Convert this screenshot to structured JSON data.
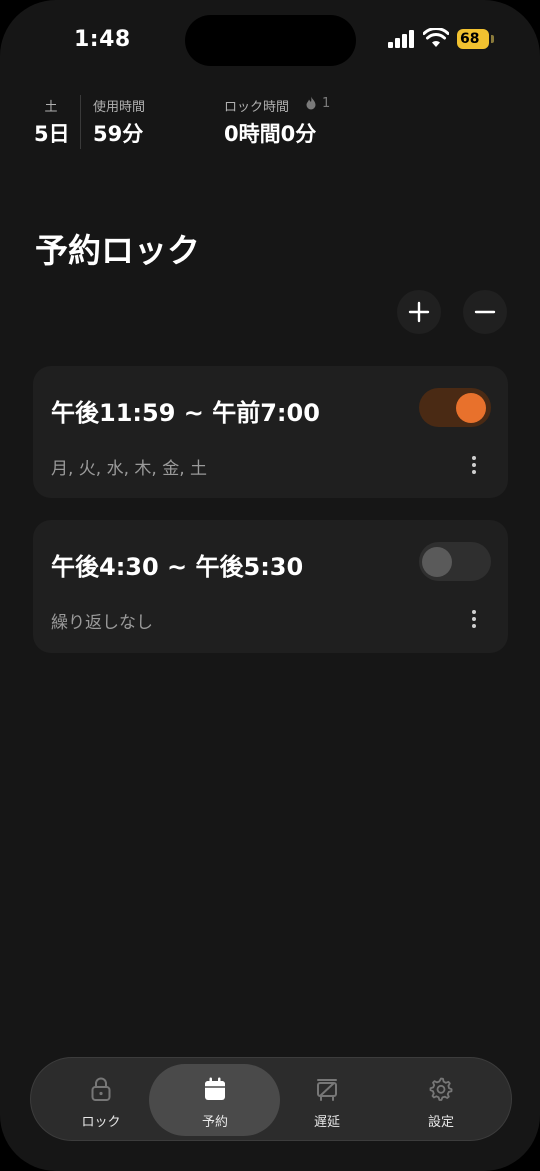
{
  "status_bar": {
    "time": "1:48",
    "battery_percent": "68",
    "signal_bars": 4,
    "charging": true
  },
  "stats": {
    "day_label": "土",
    "day_value": "5日",
    "usage_label": "使用時間",
    "usage_value": "59分",
    "lock_label": "ロック時間",
    "lock_streak": "1",
    "lock_value": "0時間0分"
  },
  "page": {
    "title": "予約ロック"
  },
  "actions": {
    "add_icon": "plus-icon",
    "remove_icon": "minus-icon"
  },
  "schedules": [
    {
      "time_range": "午後11:59 ~ 午前7:00",
      "days": "月, 火, 水, 木, 金, 土",
      "enabled": true
    },
    {
      "time_range": "午後4:30 ~ 午後5:30",
      "days": "繰り返しなし",
      "enabled": false
    }
  ],
  "tabs": [
    {
      "label": "ロック",
      "icon": "lock-icon",
      "active": false
    },
    {
      "label": "予約",
      "icon": "calendar-icon",
      "active": true
    },
    {
      "label": "遅延",
      "icon": "delay-icon",
      "active": false
    },
    {
      "label": "設定",
      "icon": "gear-icon",
      "active": false
    }
  ],
  "colors": {
    "accent": "#e8712c",
    "background": "#161616",
    "card": "#1f1f1f",
    "battery": "#f2c230"
  }
}
